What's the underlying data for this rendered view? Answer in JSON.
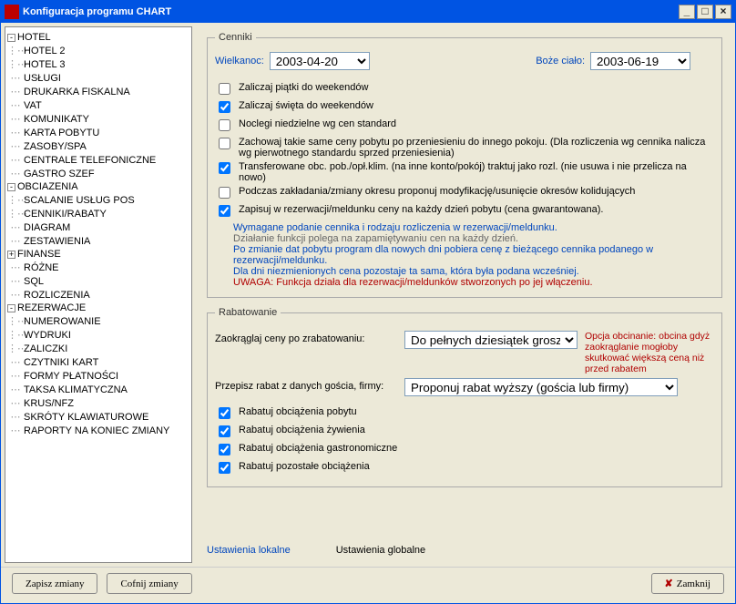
{
  "window": {
    "title": "Konfiguracja programu CHART"
  },
  "winbtns": {
    "min": "_",
    "max": "□",
    "close": "×"
  },
  "tree": {
    "hotel": {
      "pm": "-",
      "label": "HOTEL",
      "c1": "HOTEL 2",
      "c2": "HOTEL 3"
    },
    "uslugi": "USŁUGI",
    "drukarka": "DRUKARKA FISKALNA",
    "vat": "VAT",
    "komunikaty": "KOMUNIKATY",
    "karta": "KARTA POBYTU",
    "zasoby": "ZASOBY/SPA",
    "centrale": "CENTRALE TELEFONICZNE",
    "gastro": "GASTRO SZEF",
    "obciazenia": {
      "pm": "-",
      "label": "OBCIAZENIA",
      "c1": "SCALANIE USŁUG POS",
      "c2": "CENNIKI/RABATY"
    },
    "diagram": "DIAGRAM",
    "zestawienia": "ZESTAWIENIA",
    "finanse": {
      "pm": "+",
      "label": "FINANSE"
    },
    "rozne": "RÓŻNE",
    "sql": "SQL",
    "rozliczenia": "ROZLICZENIA",
    "rezerwacje": {
      "pm": "-",
      "label": "REZERWACJE",
      "c1": "NUMEROWANIE",
      "c2": "WYDRUKI",
      "c3": "ZALICZKI"
    },
    "czytniki": "CZYTNIKI KART",
    "formy": "FORMY PŁATNOŚCI",
    "taksa": "TAKSA KLIMATYCZNA",
    "krus": "KRUS/NFZ",
    "skroty": "SKRÓTY KLAWIATUROWE",
    "raporty": "RAPORTY NA KONIEC ZMIANY"
  },
  "cenniki": {
    "legend": "Cenniki",
    "wielkanoc": {
      "label": "Wielkanoc:",
      "value": "2003-04-20"
    },
    "bozecialo": {
      "label": "Boże ciało:",
      "value": "2003-06-19"
    },
    "cb1": "Zaliczaj piątki do weekendów",
    "cb2": "Zaliczaj święta do weekendów",
    "cb3": "Noclegi niedzielne wg cen standard",
    "cb4": "Zachowaj takie same ceny pobytu po przeniesieniu do innego pokoju. (Dla rozliczenia wg cennika nalicza wg pierwotnego standardu sprzed przeniesienia)",
    "cb5": "Transferowane obc. pob./opł.klim. (na inne konto/pokój) traktuj jako rozl. (nie usuwa i nie przelicza na nowo)",
    "cb6": "Podczas zakładania/zmiany okresu proponuj modyfikację/usunięcie okresów kolidujących",
    "cb7": "Zapisuj w rezerwacji/meldunku ceny na każdy dzień pobytu (cena gwarantowana).",
    "note1": "Wymagane podanie cennika i rodzaju rozliczenia w rezerwacji/meldunku.",
    "note2": "Działanie funkcji polega na zapamiętywaniu cen na każdy dzień.",
    "note3": "Po zmianie dat pobytu program dla nowych dni pobiera cenę z bieżącego cennika podanego w rezerwacji/meldunku.",
    "note4": "Dla dni niezmienionych cena pozostaje ta sama, która była podana wcześniej.",
    "warn": "UWAGA: Funkcja działa dla rezerwacji/meldunków stworzonych po jej włączeniu."
  },
  "rabat": {
    "legend": "Rabatowanie",
    "round_label": "Zaokrąglaj ceny po zrabatowaniu:",
    "round_value": "Do pełnych dziesiątek groszy",
    "round_note": "Opcja obcinanie: obcina gdyż zaokrąglanie mogłoby skutkować większą ceną niż przed rabatem",
    "copy_label": "Przepisz rabat z danych gościa, firmy:",
    "copy_value": "Proponuj rabat wyższy (gościa lub firmy)",
    "r1": "Rabatuj obciążenia pobytu",
    "r2": "Rabatuj obciążenia żywienia",
    "r3": "Rabatuj obciążenia gastronomiczne",
    "r4": "Rabatuj pozostałe obciążenia"
  },
  "links": {
    "local": "Ustawienia lokalne",
    "global": "Ustawienia globalne"
  },
  "buttons": {
    "save": "Zapisz zmiany",
    "undo": "Cofnij zmiany",
    "close": "Zamknij"
  }
}
